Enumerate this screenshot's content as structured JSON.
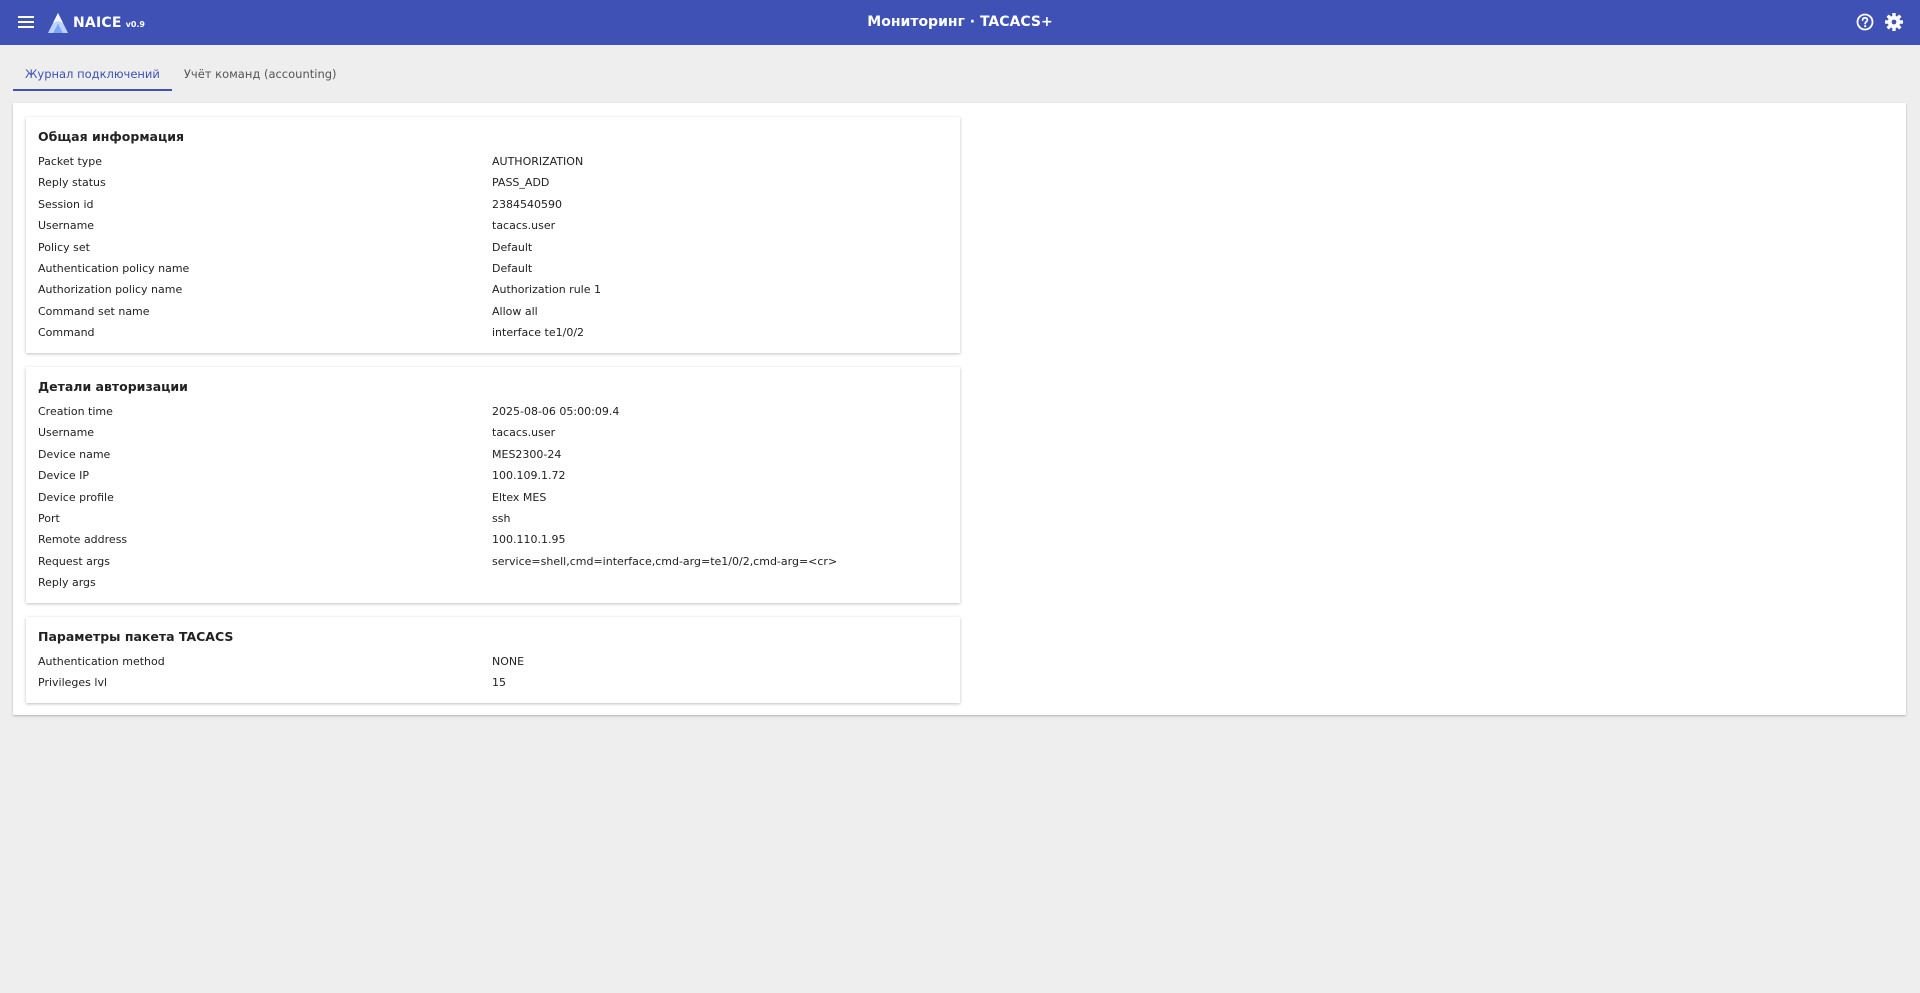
{
  "header": {
    "brand_name": "NAICE",
    "brand_version": "v0.9",
    "title": "Мониторинг · TACACS+",
    "icons": {
      "menu": "menu-icon",
      "help": "help-circle-icon",
      "settings": "gear-icon"
    },
    "colors": {
      "bar": "#3f51b5",
      "accent": "#3f51b5"
    }
  },
  "tabs": [
    {
      "label": "Журнал подключений",
      "active": true
    },
    {
      "label": "Учёт команд (accounting)",
      "active": false
    }
  ],
  "sections": [
    {
      "title": "Общая информация",
      "rows": [
        {
          "label": "Packet type",
          "value": "AUTHORIZATION"
        },
        {
          "label": "Reply status",
          "value": "PASS_ADD"
        },
        {
          "label": "Session id",
          "value": "2384540590"
        },
        {
          "label": "Username",
          "value": "tacacs.user"
        },
        {
          "label": "Policy set",
          "value": "Default"
        },
        {
          "label": "Authentication policy name",
          "value": "Default"
        },
        {
          "label": "Authorization policy name",
          "value": "Authorization rule 1"
        },
        {
          "label": "Command set name",
          "value": "Allow all"
        },
        {
          "label": "Command",
          "value": "interface te1/0/2"
        }
      ]
    },
    {
      "title": "Детали авторизации",
      "rows": [
        {
          "label": "Creation time",
          "value": "2025-08-06 05:00:09.4"
        },
        {
          "label": "Username",
          "value": "tacacs.user"
        },
        {
          "label": "Device name",
          "value": "MES2300-24"
        },
        {
          "label": "Device IP",
          "value": "100.109.1.72"
        },
        {
          "label": "Device profile",
          "value": "Eltex MES"
        },
        {
          "label": "Port",
          "value": "ssh"
        },
        {
          "label": "Remote address",
          "value": "100.110.1.95"
        },
        {
          "label": "Request args",
          "value": "service=shell,cmd=interface,cmd-arg=te1/0/2,cmd-arg=<cr>"
        },
        {
          "label": "Reply args",
          "value": ""
        }
      ]
    },
    {
      "title": "Параметры пакета TACACS",
      "rows": [
        {
          "label": "Authentication method",
          "value": "NONE"
        },
        {
          "label": "Privileges lvl",
          "value": "15"
        }
      ]
    }
  ]
}
